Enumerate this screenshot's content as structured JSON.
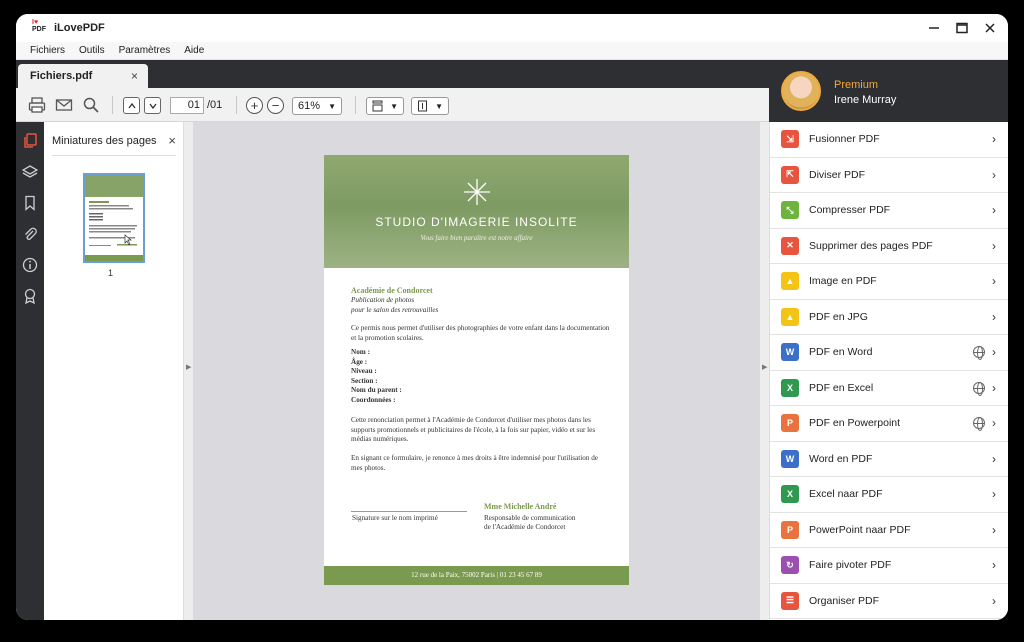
{
  "app": {
    "title": "iLovePDF",
    "logo_top": "I♥",
    "logo_bottom": "PDF"
  },
  "menu": [
    "Fichiers",
    "Outils",
    "Paramètres",
    "Aide"
  ],
  "tab": {
    "label": "Fichiers.pdf",
    "close": "×"
  },
  "toolbar": {
    "page_current": "01",
    "page_total": "/01",
    "zoom": "61%"
  },
  "thumbs": {
    "title": "Miniatures des pages",
    "close": "×",
    "page_number": "1"
  },
  "user": {
    "tier": "Premium",
    "name": "Irene Murray"
  },
  "document": {
    "studio": "STUDIO D'IMAGERIE INSOLITE",
    "tagline": "Vous faire bien paraître est notre affaire",
    "org": "Académie de Condorcet",
    "sub1": "Publication de photos",
    "sub2": "pour le salon des retrouvailles",
    "para1": "Ce permis nous permet d'utiliser des photographies de votre enfant dans la documentation et la promotion scolaires.",
    "fields": [
      "Nom :",
      "Âge :",
      "Niveau :",
      "Section :",
      "Nom du parent :",
      "Coordonnées :"
    ],
    "para2": "Cette renonciation permet à l'Académie de Condorcet d'utiliser mes photos dans les supports promotionnels et publicitaires de l'école, à la fois sur papier, vidéo et sur les médias numériques.",
    "para3": "En signant ce formulaire, je renonce à mes droits à être indemnisé pour l'utilisation de mes photos.",
    "sig_label": "Signature sur le nom imprimé",
    "signer": "Mme Michelle André",
    "role1": "Responsable de communication",
    "role2": "de l'Académie de Condorcet",
    "footer": "12 rue de la Paix, 75002 Paris | 01 23 45 67 89"
  },
  "tools": [
    {
      "label": "Fusionner PDF",
      "color": "#e8543e",
      "glyph": "⇲",
      "globe": false
    },
    {
      "label": "Diviser PDF",
      "color": "#e8543e",
      "glyph": "⇱",
      "globe": false
    },
    {
      "label": "Compresser PDF",
      "color": "#6fb33f",
      "glyph": "⤡",
      "globe": false
    },
    {
      "label": "Supprimer des pages PDF",
      "color": "#e8543e",
      "glyph": "✕",
      "globe": false
    },
    {
      "label": "Image en PDF",
      "color": "#f3c316",
      "glyph": "▲",
      "globe": false
    },
    {
      "label": "PDF en JPG",
      "color": "#f3c316",
      "glyph": "▲",
      "globe": false
    },
    {
      "label": "PDF en Word",
      "color": "#3b6fc8",
      "glyph": "W",
      "globe": true
    },
    {
      "label": "PDF en Excel",
      "color": "#2f9a4f",
      "glyph": "X",
      "globe": true
    },
    {
      "label": "PDF en Powerpoint",
      "color": "#e8733e",
      "glyph": "P",
      "globe": true
    },
    {
      "label": "Word en PDF",
      "color": "#3b6fc8",
      "glyph": "W",
      "globe": false
    },
    {
      "label": "Excel naar PDF",
      "color": "#2f9a4f",
      "glyph": "X",
      "globe": false
    },
    {
      "label": "PowerPoint naar PDF",
      "color": "#e8733e",
      "glyph": "P",
      "globe": false
    },
    {
      "label": "Faire pivoter PDF",
      "color": "#9b4fb0",
      "glyph": "↻",
      "globe": false
    },
    {
      "label": "Organiser PDF",
      "color": "#e8543e",
      "glyph": "☰",
      "globe": false
    }
  ]
}
